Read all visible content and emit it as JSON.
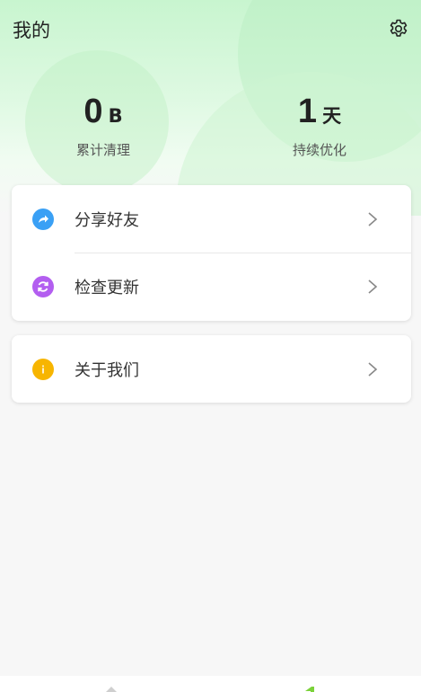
{
  "header": {
    "title": "我的",
    "settings_icon": "gear-icon"
  },
  "stats": [
    {
      "value": "0",
      "unit": "B",
      "label": "累计清理"
    },
    {
      "value": "1",
      "unit": "天",
      "label": "持续优化"
    }
  ],
  "menu": {
    "share": {
      "label": "分享好友",
      "icon": "share-icon",
      "color": "#3aa0f5"
    },
    "update": {
      "label": "检查更新",
      "icon": "refresh-icon",
      "color": "#b35ef0"
    },
    "about": {
      "label": "关于我们",
      "icon": "info-icon",
      "color": "#f7b500"
    }
  },
  "tabbar": {
    "home_icon": "home-icon",
    "mine_icon": "mine-icon",
    "active_color": "#7bd23a"
  }
}
